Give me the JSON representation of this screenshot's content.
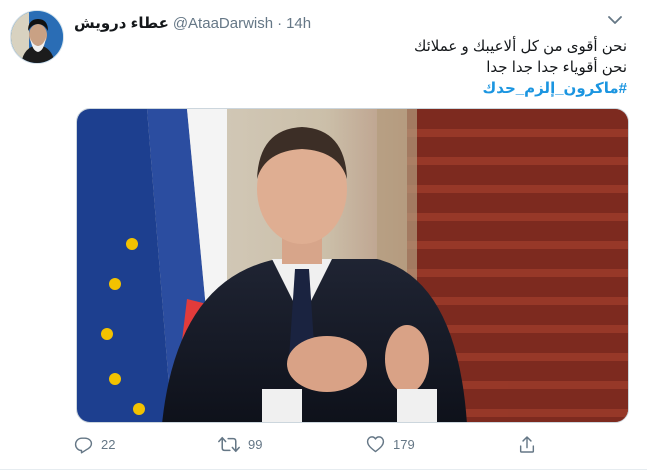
{
  "tweet": {
    "display_name": "عطاء درويش",
    "handle": "@AtaaDarwish",
    "separator": "·",
    "time": "14h",
    "lines": [
      "نحن أقوى من كل ألاعيبك و عملائك",
      "نحن أقوياء جدا جدا جدا"
    ],
    "hashtag": "#ماكرون_إلزم_حدك",
    "stats": {
      "replies": "22",
      "retweets": "99",
      "likes": "179"
    }
  },
  "icons": {
    "caret": "chevron-down-icon",
    "reply": "reply-icon",
    "retweet": "retweet-icon",
    "like": "heart-icon",
    "share": "share-icon"
  },
  "colors": {
    "link": "#1b95e0",
    "muted": "#657786",
    "text": "#14171a"
  }
}
